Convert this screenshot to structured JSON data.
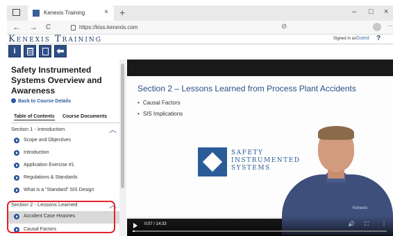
{
  "browser": {
    "tab_title": "Kenexis Training",
    "tab_close": "×",
    "new_tab": "+",
    "minimize": "–",
    "maximize": "□",
    "close": "×",
    "back": "←",
    "forward": "→",
    "reload": "C",
    "url": "https://kiss.kenexis.com",
    "more": "···"
  },
  "site": {
    "brand": "Kenexis Training",
    "signed_in_label": "Signed in as",
    "user": "Guest",
    "help_icon": "?"
  },
  "toolbar": {
    "info": "i",
    "items": [
      "info-button",
      "notes-button",
      "document-button",
      "exit-button"
    ]
  },
  "sidebar": {
    "course_title": "Safety Instrumented Systems Overview and Awareness",
    "back_link": "Back to Course Details",
    "tabs": {
      "toc": "Table of Contents",
      "documents": "Course Documents"
    },
    "sections": [
      {
        "title": "Section 1 - Introduction",
        "items": [
          "Scope and Objectives",
          "Introduction",
          "Application Exercise #1",
          "Regulations & Standards",
          "What is a \"Standard\" SIS Design"
        ]
      },
      {
        "title": "Section 2 - Lessons Learned",
        "items": [
          "Accident Case Histories",
          "Causal Factors"
        ],
        "active_item": "Accident Case Histories"
      }
    ],
    "caret": "︿"
  },
  "video": {
    "slide_title": "Section 2 – Lessons Learned from Process Plant Accidents",
    "bullets": [
      "Causal Factors",
      "SIS Implications"
    ],
    "logo_lines": [
      "SAFETY",
      "INSTRUMENTED",
      "SYSTEMS"
    ],
    "shirt_logo": "Kenexis",
    "time": "0:07 / 14:33",
    "progress_fraction": 0.008,
    "volume_icon": "🔊",
    "fullscreen_icon": "⛶",
    "menu_icon": "⋮"
  }
}
